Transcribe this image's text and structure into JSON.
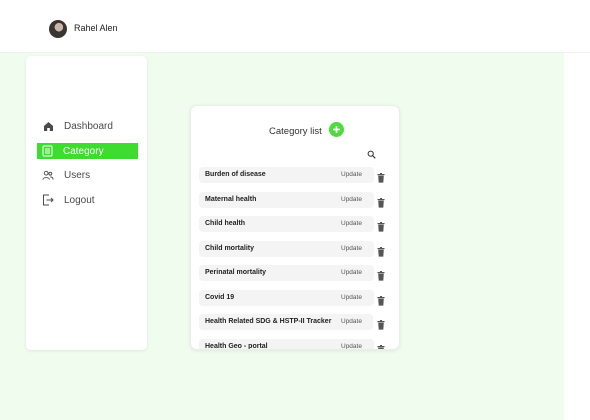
{
  "header": {
    "user_name": "Rahel Alen",
    "avatar_icon": "user-photo"
  },
  "sidebar": {
    "items": [
      {
        "label": "Dashboard",
        "icon": "home-icon",
        "active": false
      },
      {
        "label": "Category",
        "icon": "list-icon",
        "active": true
      },
      {
        "label": "Users",
        "icon": "users-icon",
        "active": false
      },
      {
        "label": "Logout",
        "icon": "logout-icon",
        "active": false
      }
    ]
  },
  "category_list": {
    "title": "Category list",
    "add_icon": "plus-icon",
    "search_icon": "search-icon",
    "update_label": "Update",
    "delete_icon": "trash-icon",
    "rows": [
      {
        "name": "Burden of disease"
      },
      {
        "name": "Maternal health"
      },
      {
        "name": "Child health"
      },
      {
        "name": "Child mortality"
      },
      {
        "name": "Perinatal mortality"
      },
      {
        "name": "Covid 19"
      },
      {
        "name": "Health Related SDG & HSTP-II Tracker"
      },
      {
        "name": "Health Geo - portal"
      }
    ]
  },
  "colors": {
    "accent": "#3ddc2f",
    "background": "#effcee",
    "row": "#f4f4f4"
  }
}
